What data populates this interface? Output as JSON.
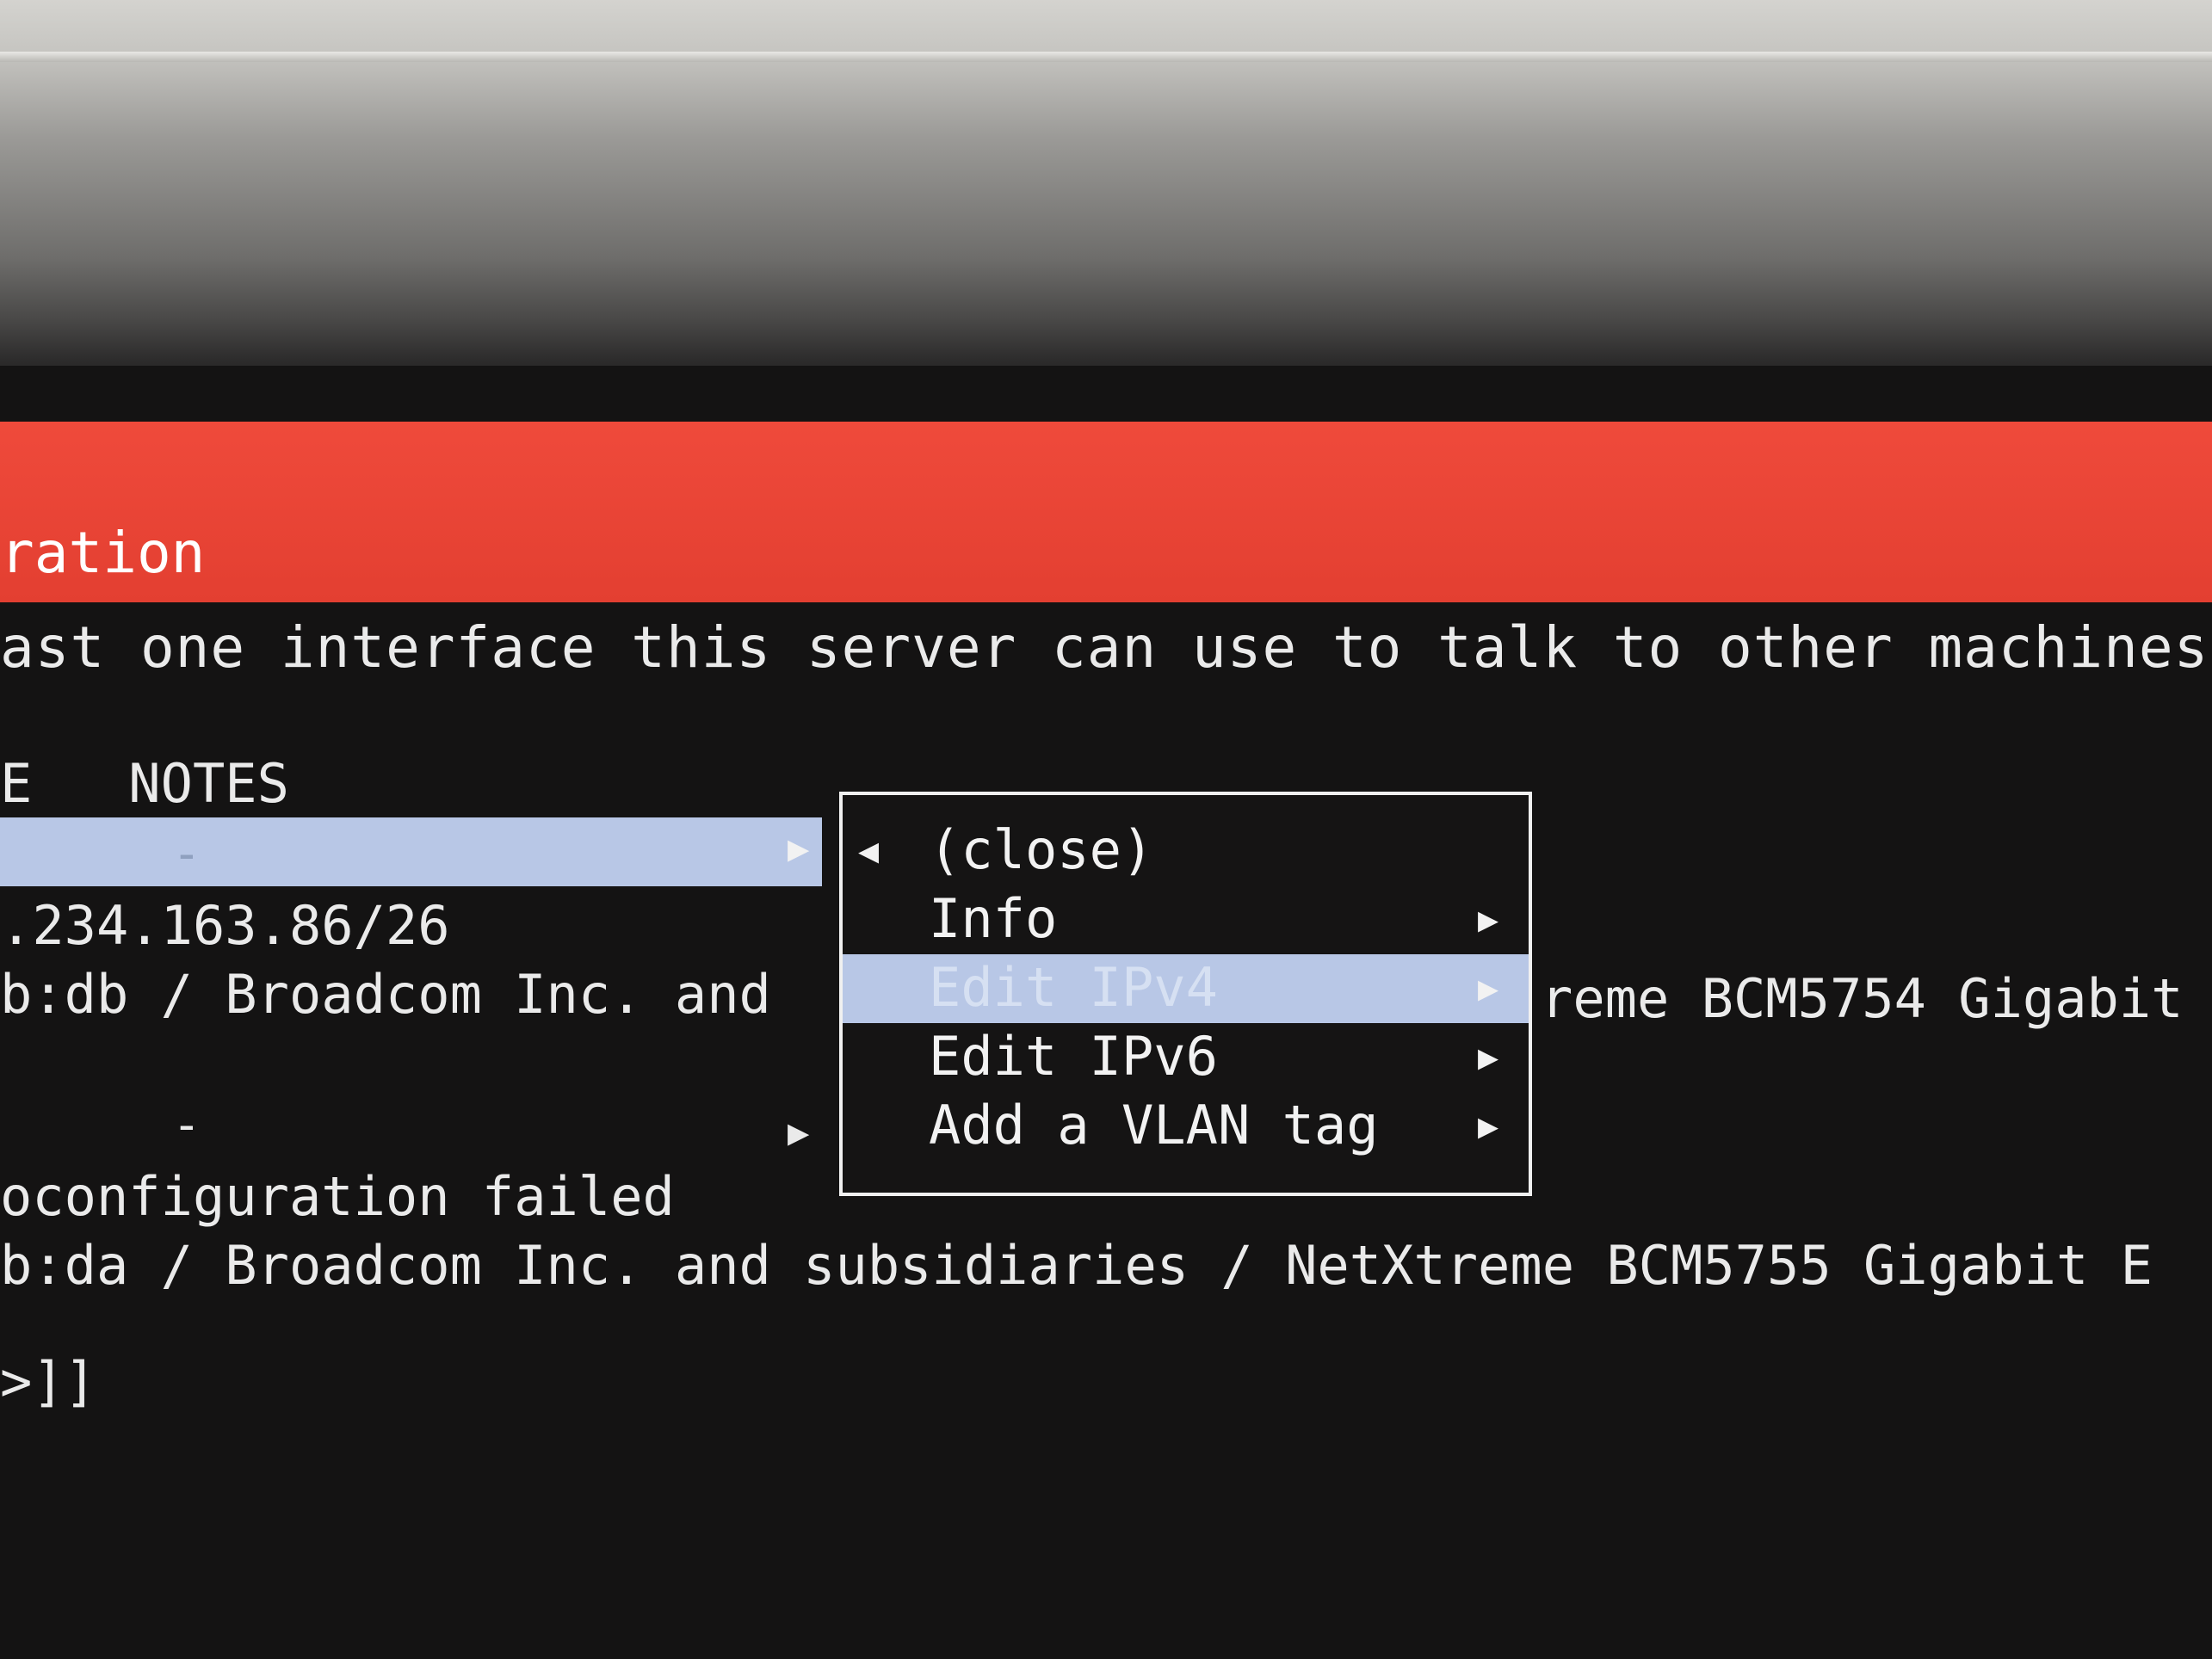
{
  "header": {
    "title": "ration"
  },
  "intro_text": "ast one interface this server can use to talk to other machines, a",
  "table": {
    "col_head": "E   NOTES",
    "selected_row_note": "-",
    "selected_row_arrow": "▶",
    "row1_ip": ".234.163.86/26",
    "row1_desc": "b:db / Broadcom Inc. and",
    "row1_desc_tail": "reme BCM5754 Gigabit",
    "row2_note": "-",
    "row2_arrow": "▶",
    "row2_status": "oconfiguration failed",
    "row2_desc": "b:da / Broadcom Inc. and subsidiaries / NetXtreme BCM5755 Gigabit E",
    "prompt": ">]]"
  },
  "menu": {
    "close_icon": "◀",
    "items": [
      {
        "label": "(close)",
        "arrow": ""
      },
      {
        "label": "Info",
        "arrow": "▶"
      },
      {
        "label": "Edit IPv4",
        "arrow": "▶",
        "selected": true
      },
      {
        "label": "Edit IPv6",
        "arrow": "▶"
      },
      {
        "label": "Add a VLAN tag",
        "arrow": "▶"
      }
    ]
  },
  "colors": {
    "header": "#e33f31",
    "highlight": "#b8c7e6",
    "background": "#141313"
  }
}
